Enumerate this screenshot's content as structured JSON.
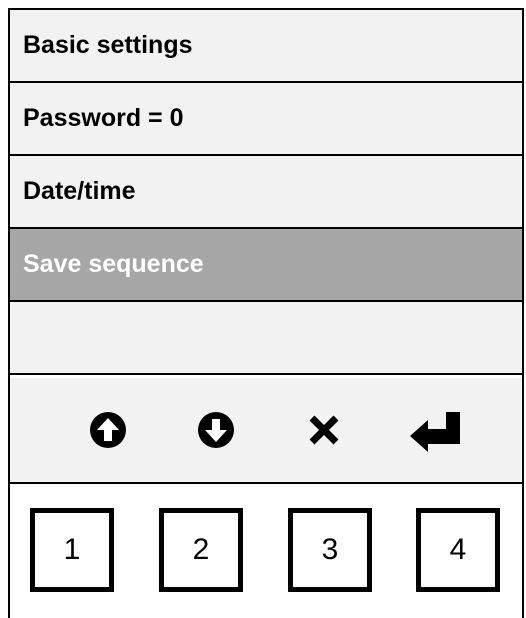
{
  "menu": {
    "items": [
      {
        "label": "Basic settings",
        "selected": false
      },
      {
        "label": "Password = 0",
        "selected": false
      },
      {
        "label": "Date/time",
        "selected": false
      },
      {
        "label": "Save sequence",
        "selected": true
      },
      {
        "label": "",
        "selected": false
      }
    ]
  },
  "nav": {
    "buttons": [
      {
        "icon": "arrow-up-circle-icon"
      },
      {
        "icon": "arrow-down-circle-icon"
      },
      {
        "icon": "close-icon"
      },
      {
        "icon": "enter-return-icon"
      }
    ]
  },
  "keypad": {
    "keys": [
      "1",
      "2",
      "3",
      "4"
    ]
  },
  "colors": {
    "menu_background": "#f2f2f2",
    "selected_background": "#a6a6a6",
    "selected_text": "#ffffff",
    "border": "#000000"
  }
}
